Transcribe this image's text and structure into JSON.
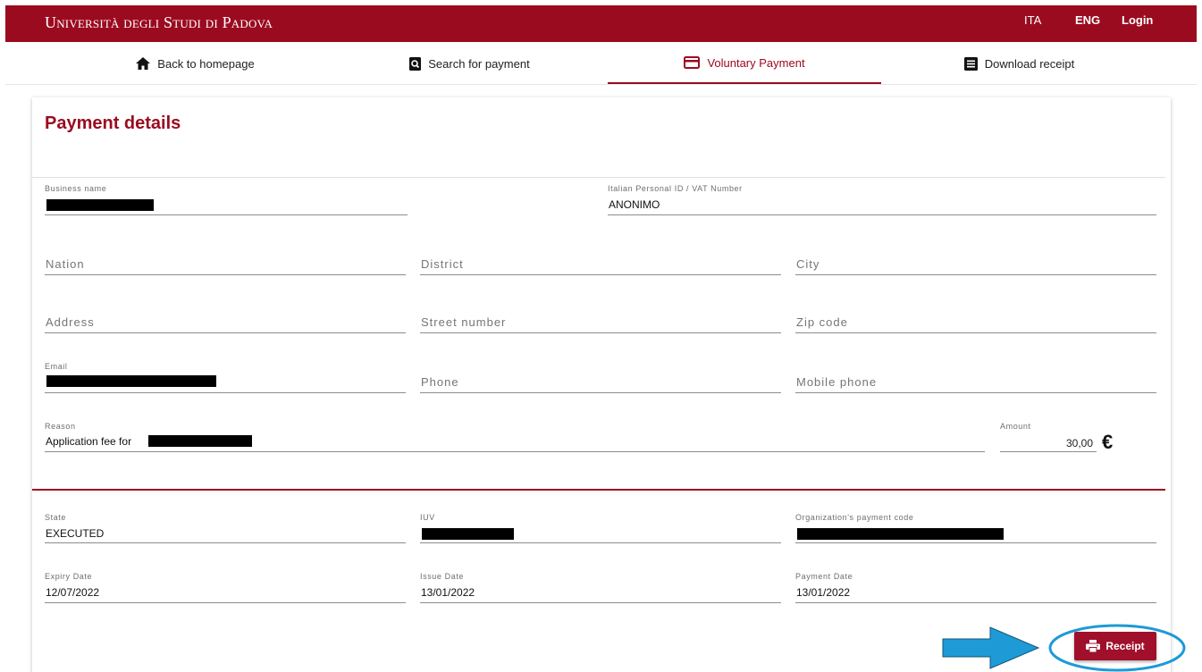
{
  "header": {
    "brand": "Università degli Studi di Padova",
    "lang_ita": "ITA",
    "lang_eng": "ENG",
    "login": "Login",
    "bg_color": "#9b0b20"
  },
  "nav": {
    "tabs": [
      {
        "label": "Back to homepage",
        "icon": "home-icon"
      },
      {
        "label": "Search for payment",
        "icon": "search-document-icon"
      },
      {
        "label": "Voluntary Payment",
        "icon": "credit-card-icon",
        "active": true
      },
      {
        "label": "Download receipt",
        "icon": "receipt-list-icon"
      }
    ]
  },
  "card": {
    "title": "Payment details",
    "accent_color": "#9b0b20"
  },
  "fields": {
    "business_name": {
      "label": "Business name"
    },
    "personal_id": {
      "label": "Italian Personal ID / VAT Number",
      "value": "ANONIMO"
    },
    "nation": {
      "placeholder": "Nation"
    },
    "district": {
      "placeholder": "District"
    },
    "city": {
      "placeholder": "City"
    },
    "address": {
      "placeholder": "Address"
    },
    "street_number": {
      "placeholder": "Street number"
    },
    "zip_code": {
      "placeholder": "Zip code"
    },
    "email": {
      "label": "Email"
    },
    "phone": {
      "placeholder": "Phone"
    },
    "mobile_phone": {
      "placeholder": "Mobile phone"
    },
    "reason": {
      "label": "Reason",
      "value": "Application fee for"
    },
    "amount": {
      "label": "Amount",
      "value": "30,00",
      "currency": "€"
    },
    "state": {
      "label": "State",
      "value": "EXECUTED"
    },
    "iuv": {
      "label": "IUV"
    },
    "org_payment_code": {
      "label": "Organization's payment code"
    },
    "expiry_date": {
      "label": "Expiry Date",
      "value": "12/07/2022"
    },
    "issue_date": {
      "label": "Issue Date",
      "value": "13/01/2022"
    },
    "payment_date": {
      "label": "Payment Date",
      "value": "13/01/2022"
    }
  },
  "actions": {
    "receipt_label": "Receipt",
    "receipt_icon": "printer-icon"
  },
  "annotations": {
    "arrow_color": "#1e9ad6",
    "highlight_color": "#1e9ad6"
  }
}
